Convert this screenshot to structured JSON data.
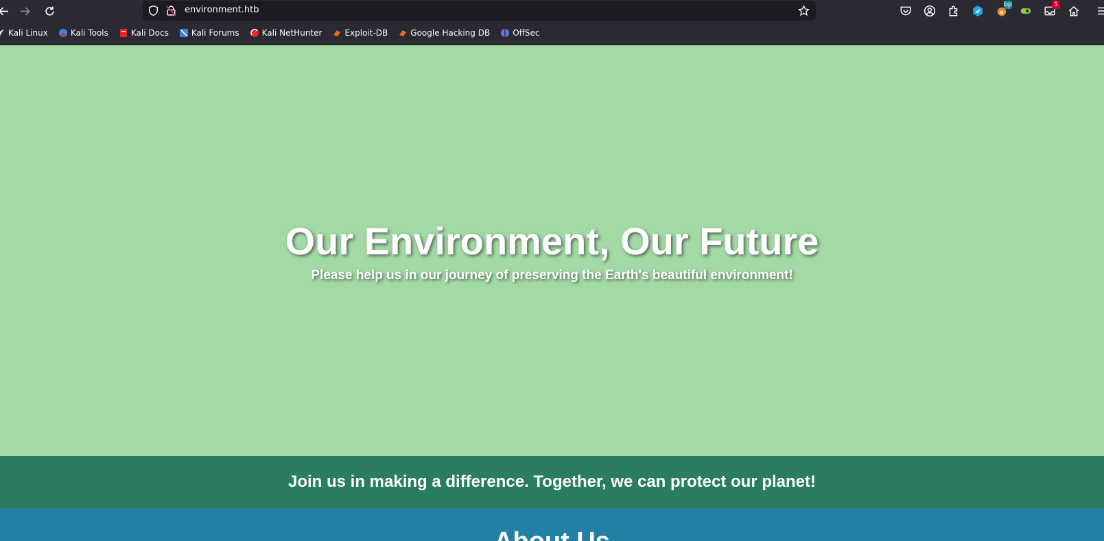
{
  "browser": {
    "url": "environment.htb",
    "bookmarks": [
      {
        "label": "Kali Linux",
        "icon": "kali-dragon-icon",
        "color": "#fbfbfe"
      },
      {
        "label": "Kali Tools",
        "icon": "kali-tools-icon",
        "color": "#3f82e4"
      },
      {
        "label": "Kali Docs",
        "icon": "kali-docs-icon",
        "color": "#e8262a"
      },
      {
        "label": "Kali Forums",
        "icon": "kali-forums-icon",
        "color": "#3f82e4"
      },
      {
        "label": "Kali NetHunter",
        "icon": "kali-nethunter-icon",
        "color": "#e8262a"
      },
      {
        "label": "Exploit-DB",
        "icon": "exploit-db-icon",
        "color": "#e96a1c"
      },
      {
        "label": "Google Hacking DB",
        "icon": "ghdb-icon",
        "color": "#e96a1c"
      },
      {
        "label": "OffSec",
        "icon": "offsec-icon",
        "color": "#5b7bd8"
      }
    ],
    "extension_badges": {
      "bp": "bp",
      "notifications": "5"
    }
  },
  "page": {
    "hero": {
      "title": "Our Environment, Our Future",
      "subtitle": "Please help us in our journey of preserving the Earth's beautiful environment!"
    },
    "join_banner": "Join us in making a difference. Together, we can protect our planet!",
    "about_heading": "About Us",
    "colors": {
      "hero_bg": "#a3d9a5",
      "banner_bg": "#2a7d60",
      "about_bg": "#227fa5"
    }
  }
}
